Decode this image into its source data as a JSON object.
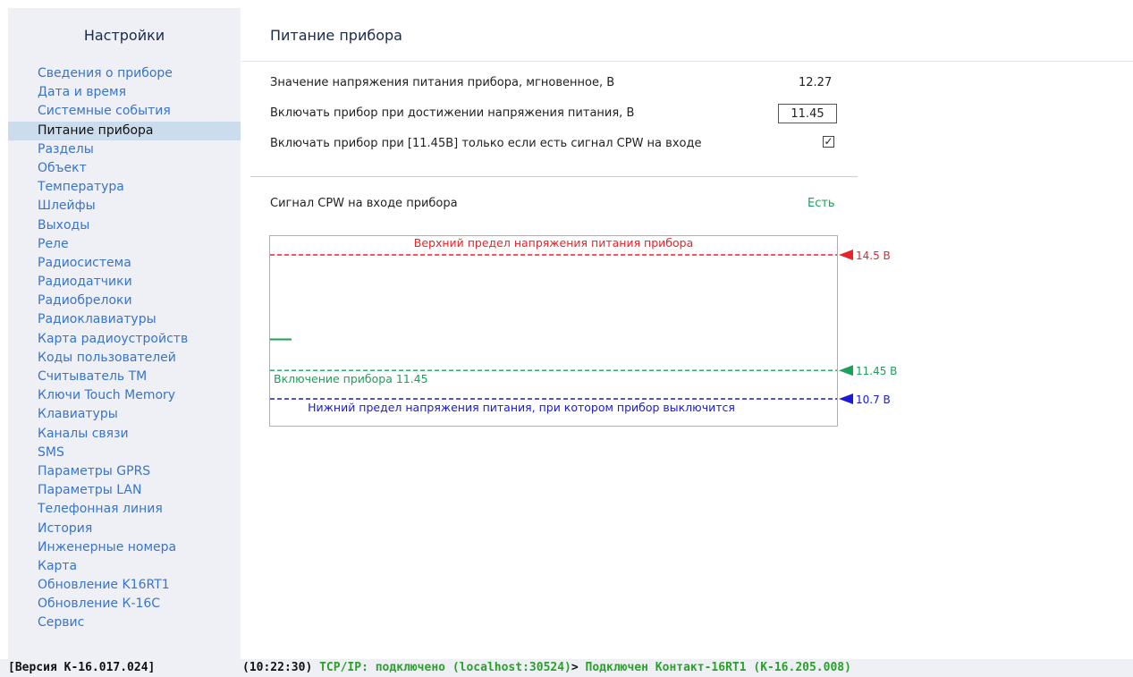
{
  "sidebar": {
    "title": "Настройки",
    "items": [
      {
        "label": "Сведения о приборе"
      },
      {
        "label": "Дата и время"
      },
      {
        "label": "Системные события"
      },
      {
        "label": "Питание прибора",
        "active": true
      },
      {
        "label": "Разделы"
      },
      {
        "label": "Объект"
      },
      {
        "label": "Температура"
      },
      {
        "label": "Шлейфы"
      },
      {
        "label": "Выходы"
      },
      {
        "label": "Реле"
      },
      {
        "label": "Радиосистема"
      },
      {
        "label": "Радиодатчики"
      },
      {
        "label": "Радиобрелоки"
      },
      {
        "label": "Радиоклавиатуры"
      },
      {
        "label": "Карта радиоустройств"
      },
      {
        "label": "Коды пользователей"
      },
      {
        "label": "Считыватель ТМ"
      },
      {
        "label": "Ключи Touch Memory"
      },
      {
        "label": "Клавиатуры"
      },
      {
        "label": "Каналы связи"
      },
      {
        "label": "SMS"
      },
      {
        "label": "Параметры GPRS"
      },
      {
        "label": "Параметры LAN"
      },
      {
        "label": "Телефонная линия"
      },
      {
        "label": "История"
      },
      {
        "label": "Инженерные номера"
      },
      {
        "label": "Карта"
      },
      {
        "label": "Обновление K16RT1"
      },
      {
        "label": "Обновление К-16С"
      },
      {
        "label": "Сервис"
      }
    ]
  },
  "main": {
    "title": "Питание прибора",
    "voltage_label": "Значение напряжения питания прибора, мгновенное, В",
    "voltage_value": "12.27",
    "switch_on_label": "Включать прибор при достижении напряжения питания, В",
    "switch_on_value": "11.45",
    "cpw_only_label": "Включать прибор при [11.45В] только если есть сигнал CPW на входе",
    "cpw_only_checked": true,
    "cpw_signal_label": "Сигнал CPW на входе прибора",
    "cpw_signal_value": "Есть"
  },
  "chart_data": {
    "type": "line",
    "lines": [
      {
        "label": "Верхний предел напряжения питания прибора",
        "value": 14.5,
        "marker": "14.5 В",
        "color": "#e8232a"
      },
      {
        "label": "Включение прибора 11.45",
        "value": 11.45,
        "marker": "11.45 В",
        "color": "#1da05a"
      },
      {
        "label": "Нижний предел напряжения питания, при котором прибор выключится",
        "value": 10.7,
        "marker": "10.7 В",
        "color": "#1a1ad6"
      }
    ],
    "current_value": 12.27,
    "current_color": "#1da05a",
    "ylim": [
      10.7,
      14.5
    ]
  },
  "statusbar": {
    "version": "[Версия К-16.017.024]",
    "time": "(10:22:30)",
    "connection": "TCP/IP: подключено (localhost:30524)",
    "arrow": ">",
    "device": "Подключен Контакт-16RT1 (К-16.205.008)"
  }
}
